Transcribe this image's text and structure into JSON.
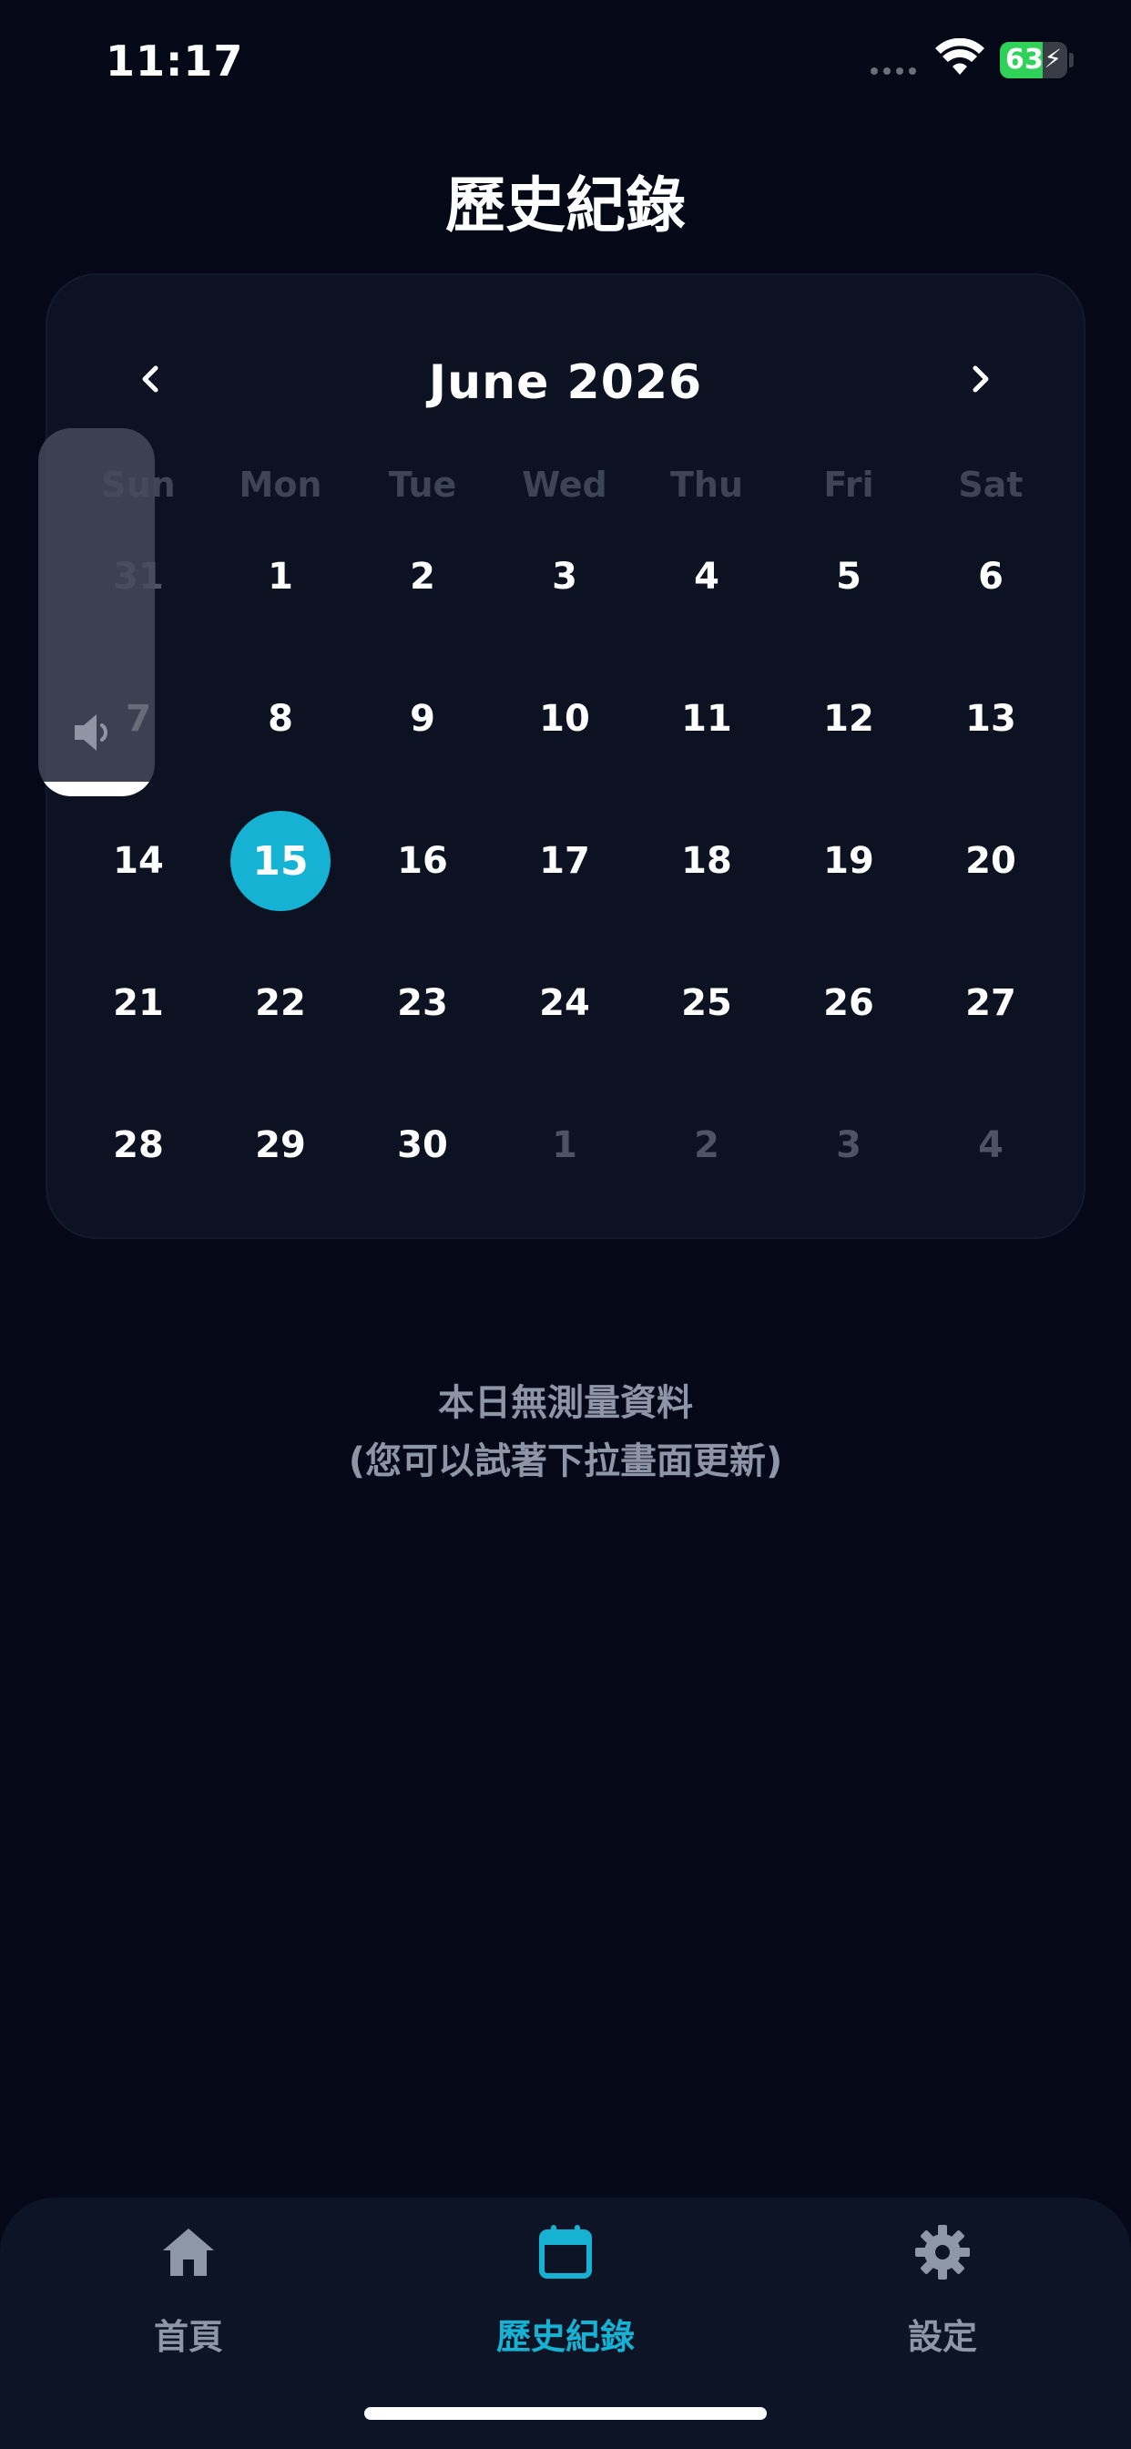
{
  "status_bar": {
    "time": "11:17",
    "battery_level": "63",
    "battery_fraction": 0.63,
    "battery_color": "#2fd158"
  },
  "page": {
    "title": "歷史紀錄"
  },
  "calendar": {
    "month_label": "June 2026",
    "prev_icon": "chevron-left-icon",
    "next_icon": "chevron-right-icon",
    "weekdays": [
      "Sun",
      "Mon",
      "Tue",
      "Wed",
      "Thu",
      "Fri",
      "Sat"
    ],
    "weeks": [
      [
        {
          "label": "31",
          "muted": true
        },
        {
          "label": "1"
        },
        {
          "label": "2"
        },
        {
          "label": "3"
        },
        {
          "label": "4"
        },
        {
          "label": "5"
        },
        {
          "label": "6"
        }
      ],
      [
        {
          "label": "7"
        },
        {
          "label": "8"
        },
        {
          "label": "9"
        },
        {
          "label": "10"
        },
        {
          "label": "11"
        },
        {
          "label": "12"
        },
        {
          "label": "13"
        }
      ],
      [
        {
          "label": "14"
        },
        {
          "label": "15",
          "selected": true
        },
        {
          "label": "16"
        },
        {
          "label": "17"
        },
        {
          "label": "18"
        },
        {
          "label": "19"
        },
        {
          "label": "20"
        }
      ],
      [
        {
          "label": "21"
        },
        {
          "label": "22"
        },
        {
          "label": "23"
        },
        {
          "label": "24"
        },
        {
          "label": "25"
        },
        {
          "label": "26"
        },
        {
          "label": "27"
        }
      ],
      [
        {
          "label": "28"
        },
        {
          "label": "29"
        },
        {
          "label": "30"
        },
        {
          "label": "1",
          "muted": true
        },
        {
          "label": "2",
          "muted": true
        },
        {
          "label": "3",
          "muted": true
        },
        {
          "label": "4",
          "muted": true
        }
      ]
    ],
    "selected_color": "#16b2d4"
  },
  "volume_hud": {
    "icon": "speaker-icon",
    "level": 0.04
  },
  "empty_state": {
    "line1": "本日無測量資料",
    "line2": "(您可以試著下拉畫面更新)"
  },
  "tab_bar": {
    "tabs": [
      {
        "label": "首頁",
        "icon": "home-icon",
        "active": false
      },
      {
        "label": "歷史紀錄",
        "icon": "calendar-icon",
        "active": true
      },
      {
        "label": "設定",
        "icon": "gear-icon",
        "active": false
      }
    ],
    "active_color": "#16b2d4",
    "inactive_color": "#8e97a8"
  }
}
